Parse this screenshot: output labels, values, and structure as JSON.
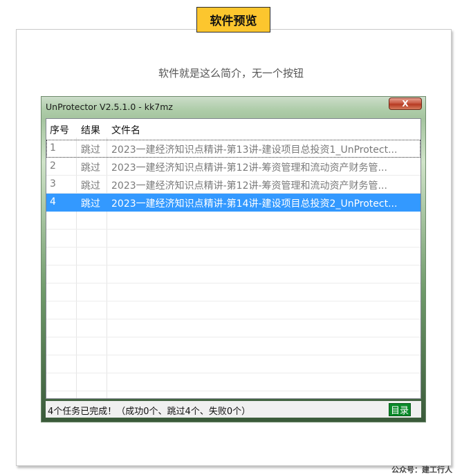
{
  "badge": "软件预览",
  "subtitle": "软件就是这么简介，无一个按钮",
  "window": {
    "title": "UnProtector V2.5.1.0 - kk7mz",
    "close_label": "X"
  },
  "list": {
    "columns": [
      "序号",
      "结果",
      "文件名"
    ],
    "rows": [
      {
        "no": "1",
        "result": "跳过",
        "file": "2023一建经济知识点精讲-第13讲-建设项目总投资1_UnProtect..."
      },
      {
        "no": "2",
        "result": "跳过",
        "file": "2023一建经济知识点精讲-第12讲-筹资管理和流动资产财务管..."
      },
      {
        "no": "3",
        "result": "跳过",
        "file": "2023一建经济知识点精讲-第12讲-筹资管理和流动资产财务管..."
      },
      {
        "no": "4",
        "result": "跳过",
        "file": "2023一建经济知识点精讲-第14讲-建设项目总投资2_UnProtect..."
      }
    ]
  },
  "status": {
    "text": "4个任务已完成！（成功0个、跳过4个、失败0个）",
    "dir_button": "目录"
  },
  "watermark": "公众号：建工行人"
}
